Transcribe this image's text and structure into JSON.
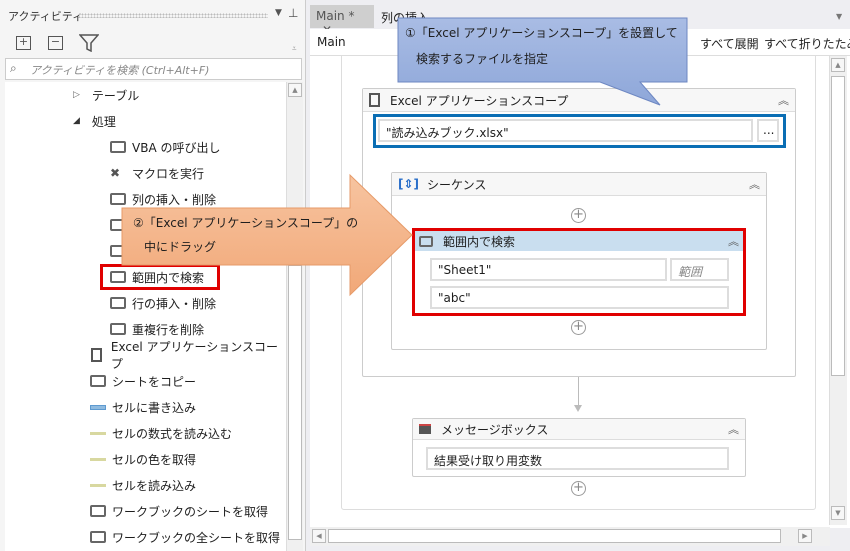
{
  "activities_panel": {
    "title": "アクティビティ",
    "search_placeholder": "アクティビティを検索 (Ctrl+Alt+F)",
    "tree": [
      {
        "label": "テーブル",
        "level": 1,
        "expanded": false
      },
      {
        "label": "処理",
        "level": 1,
        "expanded": true
      },
      {
        "label": "VBA の呼び出し",
        "level": 2
      },
      {
        "label": "マクロを実行",
        "level": 2
      },
      {
        "label": "列の挿入・削除",
        "level": 2
      },
      {
        "label": "範囲内で検索",
        "level": 2,
        "highlighted": true
      },
      {
        "label": "行の挿入・削除",
        "level": 2
      },
      {
        "label": "重複行を削除",
        "level": 2
      },
      {
        "label": "Excel アプリケーションスコープ",
        "level": 1
      },
      {
        "label": "シートをコピー",
        "level": 1
      },
      {
        "label": "セルに書き込み",
        "level": 1
      },
      {
        "label": "セルの数式を読み込む",
        "level": 1
      },
      {
        "label": "セルの色を取得",
        "level": 1
      },
      {
        "label": "セルを読み込み",
        "level": 1
      },
      {
        "label": "ワークブックのシートを取得",
        "level": 1
      },
      {
        "label": "ワークブックの全シートを取得",
        "level": 1
      }
    ]
  },
  "designer": {
    "tabs": [
      {
        "label": "Main *",
        "active": true
      },
      {
        "label": "列の挿入"
      }
    ],
    "breadcrumb": "Main",
    "expand_all": "すべて展開",
    "collapse_all": "すべて折りたたみ",
    "excel_scope": {
      "title": "Excel アプリケーションスコープ",
      "path": "\"読み込みブック.xlsx\"",
      "browse": "..."
    },
    "sequence": {
      "title": "シーケンス"
    },
    "find_range": {
      "title": "範囲内で検索",
      "sheet": "\"Sheet1\"",
      "range_placeholder": "範囲",
      "value": "\"abc\""
    },
    "message_box": {
      "title": "メッセージボックス",
      "text": "結果受け取り用変数"
    }
  },
  "annotations": {
    "callout1": [
      "①「Excel アプリケーションスコープ」を設置して",
      "検索するファイルを指定"
    ],
    "callout2": [
      "②「Excel アプリケーションスコープ」の",
      "中にドラッグ"
    ]
  },
  "colors": {
    "highlight_red": "#e00000",
    "highlight_blue": "#0a6eb4",
    "callout_blue": "#9db2df",
    "arrow_orange": "#f4b183",
    "activity_header": "#c9deef"
  }
}
